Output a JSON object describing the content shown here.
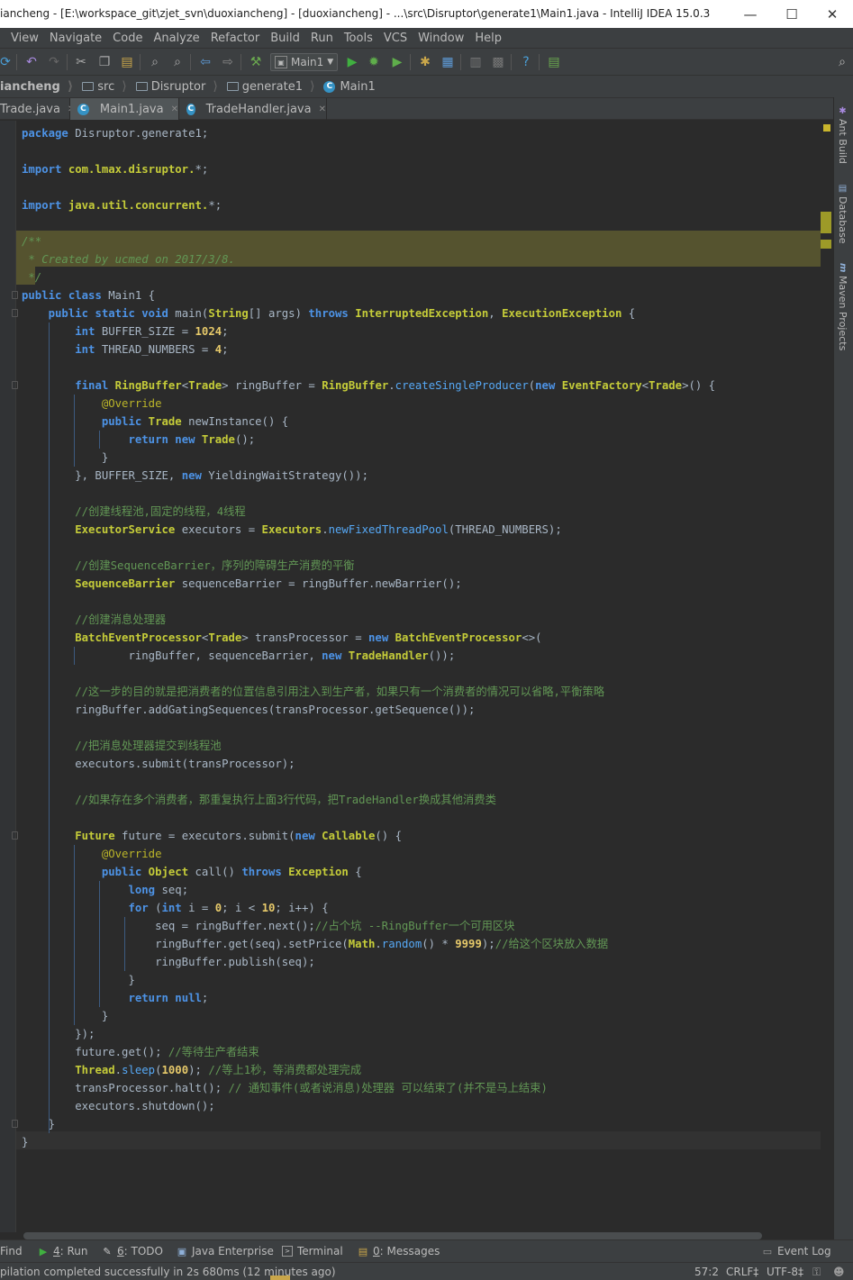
{
  "window": {
    "title": "iancheng - [E:\\workspace_git\\zjet_svn\\duoxiancheng] - [duoxiancheng] - ...\\src\\Disruptor\\generate1\\Main1.java - IntelliJ IDEA 15.0.3",
    "minimize_glyph": "—",
    "maximize_glyph": "☐",
    "close_glyph": "✕"
  },
  "menu": [
    "View",
    "Navigate",
    "Code",
    "Analyze",
    "Refactor",
    "Build",
    "Run",
    "Tools",
    "VCS",
    "Window",
    "Help"
  ],
  "toolbar": {
    "run_config": "Main1",
    "icons": [
      "sync-icon",
      "undo-icon",
      "redo-icon",
      "cut-icon",
      "copy-icon",
      "paste-icon",
      "find-icon",
      "replace-icon",
      "back-icon",
      "forward-icon",
      "build-icon",
      "run-icon",
      "debug-icon",
      "coverage-icon",
      "sdk-icon",
      "stop-icon",
      "android-icon",
      "help-icon",
      "structure-icon",
      "search-everywhere-icon"
    ]
  },
  "breadcrumb": [
    "iancheng",
    "src",
    "Disruptor",
    "generate1",
    "Main1"
  ],
  "tabs": [
    {
      "label": "Trade.java",
      "active": false
    },
    {
      "label": "Main1.java",
      "active": true
    },
    {
      "label": "TradeHandler.java",
      "active": false
    }
  ],
  "right_sidebar": [
    "Ant Build",
    "Database",
    "Maven Projects"
  ],
  "bottom_tools": [
    {
      "label": "Find",
      "key": ""
    },
    {
      "label": ": Run",
      "key": "4"
    },
    {
      "label": ": TODO",
      "key": "6"
    },
    {
      "label": "Java Enterprise",
      "key": ""
    },
    {
      "label": "Terminal",
      "key": ""
    },
    {
      "label": ": Messages",
      "key": "0"
    },
    {
      "label": "Event Log",
      "key": ""
    }
  ],
  "status": {
    "message": "pilation completed successfully in 2s 680ms (12 minutes ago)",
    "position": "57:2",
    "line_sep": "CRLF‡",
    "encoding": "UTF-8‡"
  },
  "code": [
    "package Disruptor.generate1;",
    "",
    "import com.lmax.disruptor.*;",
    "",
    "import java.util.concurrent.*;",
    "",
    "/**",
    " * Created by ucmed on 2017/3/8.",
    " */",
    "public class Main1 {",
    "    public static void main(String[] args) throws InterruptedException, ExecutionException {",
    "        int BUFFER_SIZE = 1024;",
    "        int THREAD_NUMBERS = 4;",
    "",
    "        final RingBuffer<Trade> ringBuffer = RingBuffer.createSingleProducer(new EventFactory<Trade>() {",
    "            @Override",
    "            public Trade newInstance() {",
    "                return new Trade();",
    "            }",
    "        }, BUFFER_SIZE, new YieldingWaitStrategy());",
    "",
    "        //创建线程池,固定的线程，4线程",
    "        ExecutorService executors = Executors.newFixedThreadPool(THREAD_NUMBERS);",
    "",
    "        //创建SequenceBarrier，序列的障碍生产消费的平衡",
    "        SequenceBarrier sequenceBarrier = ringBuffer.newBarrier();",
    "",
    "        //创建消息处理器",
    "        BatchEventProcessor<Trade> transProcessor = new BatchEventProcessor<>(",
    "                ringBuffer, sequenceBarrier, new TradeHandler());",
    "",
    "        //这一步的目的就是把消费者的位置信息引用注入到生产者，如果只有一个消费者的情况可以省略,平衡策略",
    "        ringBuffer.addGatingSequences(transProcessor.getSequence());",
    "",
    "        //把消息处理器提交到线程池",
    "        executors.submit(transProcessor);",
    "",
    "        //如果存在多个消费者，那重复执行上面3行代码，把TradeHandler换成其他消费类",
    "",
    "        Future future = executors.submit(new Callable() {",
    "            @Override",
    "            public Object call() throws Exception {",
    "                long seq;",
    "                for (int i = 0; i < 10; i++) {",
    "                    seq = ringBuffer.next();//占个坑 --RingBuffer一个可用区块",
    "                    ringBuffer.get(seq).setPrice(Math.random() * 9999);//给这个区块放入数据",
    "                    ringBuffer.publish(seq);",
    "                }",
    "                return null;",
    "            }",
    "        });",
    "        future.get(); //等待生产者结束",
    "        Thread.sleep(1000); //等上1秒，等消费都处理完成",
    "        transProcessor.halt(); // 通知事件(或者说消息)处理器 可以结束了(并不是马上结束)",
    "        executors.shutdown();",
    "    }",
    "}"
  ]
}
